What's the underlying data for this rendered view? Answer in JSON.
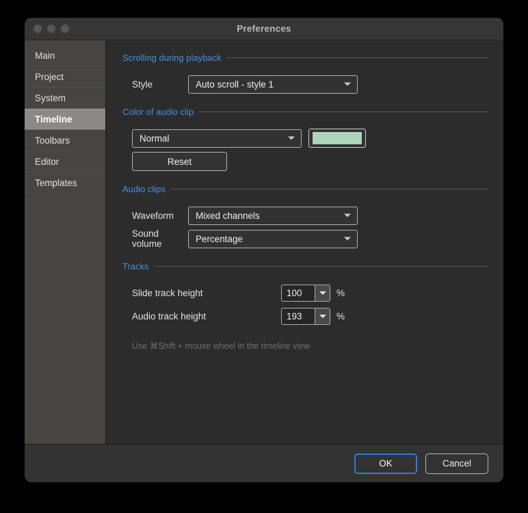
{
  "window": {
    "title": "Preferences",
    "traffic_lights": [
      "close-button",
      "minimize-button",
      "zoom-button"
    ]
  },
  "sidebar": {
    "items": [
      {
        "label": "Main",
        "selected": false
      },
      {
        "label": "Project",
        "selected": false
      },
      {
        "label": "System",
        "selected": false
      },
      {
        "label": "Timeline",
        "selected": true
      },
      {
        "label": "Toolbars",
        "selected": false
      },
      {
        "label": "Editor",
        "selected": false
      },
      {
        "label": "Templates",
        "selected": false
      }
    ]
  },
  "sections": {
    "scrolling": {
      "title": "Scrolling during playback",
      "style_label": "Style",
      "style_value": "Auto scroll - style 1"
    },
    "color": {
      "title": "Color of audio clip",
      "mode_value": "Normal",
      "swatch_color": "#aed4bc",
      "reset_label": "Reset"
    },
    "audio_clips": {
      "title": "Audio clips",
      "waveform_label": "Waveform",
      "waveform_value": "Mixed channels",
      "volume_label": "Sound volume",
      "volume_value": "Percentage"
    },
    "tracks": {
      "title": "Tracks",
      "slide_label": "Slide track height",
      "slide_value": "100",
      "slide_unit": "%",
      "audio_label": "Audio track height",
      "audio_value": "193",
      "audio_unit": "%",
      "hint": "Use ⌘Shift + mouse wheel in the timeline view"
    }
  },
  "footer": {
    "ok_label": "OK",
    "cancel_label": "Cancel"
  },
  "colors": {
    "accent_blue": "#4a8fe0",
    "focus_blue": "#2a7fe0",
    "swatch_green": "#aed4bc",
    "sidebar_bg": "#474540",
    "selected_bg": "#8c8a85"
  }
}
